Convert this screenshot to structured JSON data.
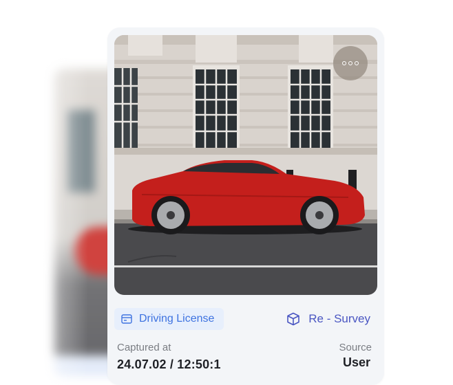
{
  "card": {
    "badge": {
      "label": "Driving License",
      "icon": "id-card-icon",
      "color": "#3d72e0"
    },
    "action": {
      "label": "Re - Survey",
      "icon": "cube-icon",
      "color": "#4a56c2"
    },
    "captured": {
      "label": "Captured at",
      "value": "24.07.02 / 12:50:1"
    },
    "source": {
      "label": "Source",
      "value": "User"
    },
    "menu": {
      "icon": "more-horizontal-icon"
    }
  }
}
